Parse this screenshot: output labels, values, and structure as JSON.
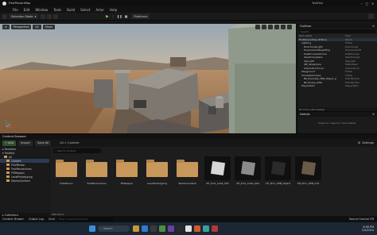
{
  "window": {
    "title": "FirstPersonMap",
    "project_name": "TestFast"
  },
  "menu": [
    "File",
    "Edit",
    "Window",
    "Tools",
    "Build",
    "Select",
    "Actor",
    "Help"
  ],
  "toolbar": {
    "mode": "Selection Mode",
    "platforms": "Platforms"
  },
  "viewport": {
    "view_mode": "Perspective",
    "lit": "Lit",
    "show": "Show"
  },
  "outliner": {
    "title": "Outliner",
    "search_placeholder": "Search...",
    "col_label": "Item Label",
    "col_type": "Type",
    "rows": [
      {
        "name": "FirstPersonMap (Editor)",
        "type": "World",
        "indent": 0
      },
      {
        "name": "Lighting",
        "type": "Folder",
        "indent": 1
      },
      {
        "name": "DirectionalLight",
        "type": "Directional",
        "indent": 2
      },
      {
        "name": "ExponentialHeightFog",
        "type": "ExponentialH",
        "indent": 2
      },
      {
        "name": "PostProcessVolume",
        "type": "PostProcess",
        "indent": 2
      },
      {
        "name": "SkyAtmosphere",
        "type": "SkyAtmosph",
        "indent": 2
      },
      {
        "name": "SkyLight",
        "type": "SkyLight",
        "indent": 2
      },
      {
        "name": "SM_SkySphere",
        "type": "StaticMesh",
        "indent": 2
      },
      {
        "name": "VolumetricCloud",
        "type": "VolumetricC",
        "indent": 2
      },
      {
        "name": "Playground",
        "type": "Folder",
        "indent": 1
      },
      {
        "name": "SimulatedCubes",
        "type": "Folder",
        "indent": 1
      },
      {
        "name": "BP_Example_VDB_Object_p",
        "type": "Edit BP_Exa",
        "indent": 2
      },
      {
        "name": "BP_Pickup_Rifle",
        "type": "Edit BP_Pick",
        "indent": 2
      },
      {
        "name": "PlayerStart",
        "type": "PlayerStart",
        "indent": 1
      }
    ],
    "footer": "84 actors (84 loaded)"
  },
  "details": {
    "title": "Details",
    "hint": "Select an object to view details."
  },
  "content_browser": {
    "title": "Content Browser",
    "add_label": "Add",
    "import_label": "Import",
    "save_all_label": "Save All",
    "path": "All > Content",
    "settings_label": "Settings",
    "search_placeholder": "Search Content",
    "favorites_label": "Favorites",
    "tree_root": "TestFast",
    "tree": [
      "All",
      "Content",
      "FirstPerson",
      "FirstPersonArms",
      "FPWeapon",
      "LevelPrototyping",
      "StarterContent"
    ],
    "collections_label": "Collections",
    "item_count": "966 items",
    "items": [
      {
        "name": "FirstPerson",
        "kind": "folder"
      },
      {
        "name": "FirstPersonArms",
        "kind": "folder"
      },
      {
        "name": "FPWeapon",
        "kind": "folder"
      },
      {
        "name": "LevelPrototyping",
        "kind": "folder"
      },
      {
        "name": "StarterContent",
        "kind": "folder"
      },
      {
        "name": "VH_Prox_Cube_001",
        "kind": "asset"
      },
      {
        "name": "VH_Prox_Cube_002",
        "kind": "asset"
      },
      {
        "name": "VH_Prox_VDB_Object",
        "kind": "asset"
      },
      {
        "name": "VH_Prox_VDB_mat",
        "kind": "asset"
      }
    ]
  },
  "statusbar": {
    "content_drawer": "Content Drawer",
    "output_log": "Output Log",
    "cmd": "Cmd",
    "console_placeholder": "Enter Console Command",
    "source_control": "Source Control Off"
  },
  "taskbar": {
    "search_placeholder": "Search",
    "time": "6:56 PM",
    "date": "1/5/2024"
  }
}
